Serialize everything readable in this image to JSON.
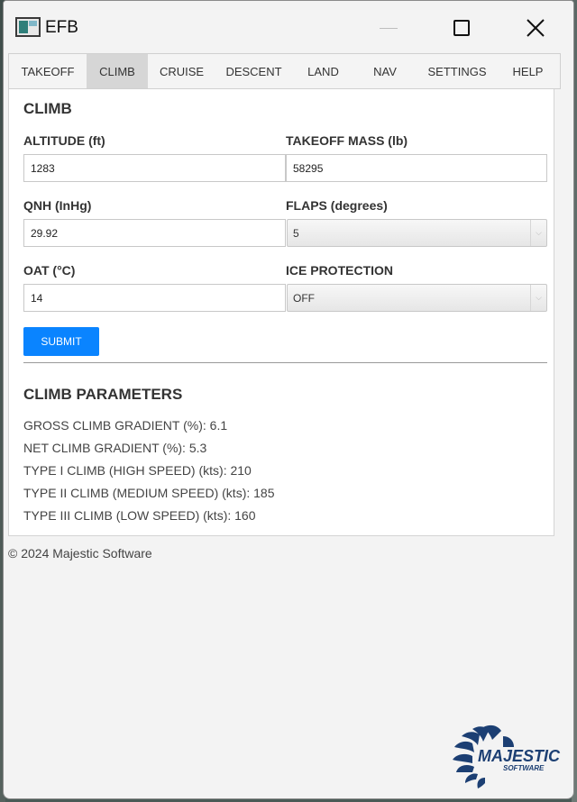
{
  "window": {
    "title": "EFB"
  },
  "tabs": [
    {
      "label": "TAKEOFF",
      "active": false
    },
    {
      "label": "CLIMB",
      "active": true
    },
    {
      "label": "CRUISE",
      "active": false
    },
    {
      "label": "DESCENT",
      "active": false
    },
    {
      "label": "LAND",
      "active": false
    },
    {
      "label": "NAV",
      "active": false
    },
    {
      "label": "SETTINGS",
      "active": false
    },
    {
      "label": "HELP",
      "active": false
    }
  ],
  "form": {
    "title": "CLIMB",
    "altitude": {
      "label": "ALTITUDE (ft)",
      "value": "1283"
    },
    "takeoff_mass": {
      "label": "TAKEOFF MASS (lb)",
      "value": "58295"
    },
    "qnh": {
      "label": "QNH (InHg)",
      "value": "29.92"
    },
    "flaps": {
      "label": "FLAPS (degrees)",
      "value": "5"
    },
    "oat": {
      "label": "OAT (°C)",
      "value": "14"
    },
    "ice_protection": {
      "label": "ICE PROTECTION",
      "value": "OFF"
    },
    "submit_label": "SUBMIT"
  },
  "results": {
    "title": "CLIMB PARAMETERS",
    "lines": [
      "GROSS CLIMB GRADIENT (%): 6.1",
      "NET CLIMB GRADIENT (%): 5.3",
      "TYPE I CLIMB (HIGH SPEED) (kts): 210",
      "TYPE II CLIMB (MEDIUM SPEED) (kts): 185",
      "TYPE III CLIMB (LOW SPEED) (kts): 160"
    ]
  },
  "footer": {
    "text": "© 2024 Majestic Software"
  },
  "logo": {
    "line1": "MAJESTIC",
    "line2": "SOFTWARE",
    "color": "#1c3f73"
  },
  "colors": {
    "accent": "#0a84ff",
    "active_tab": "#d6d6d6"
  }
}
